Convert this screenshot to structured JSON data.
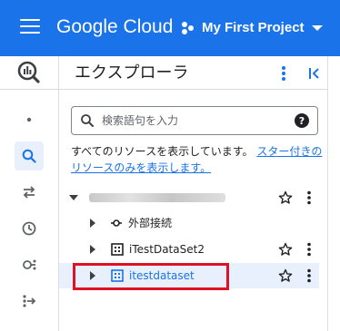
{
  "topbar": {
    "menu_icon": "hamburger-menu-icon",
    "logo_text": "Google Cloud",
    "project_name": "My First Project",
    "project_icon": "project-dots-icon",
    "dropdown_icon": "caret-down-icon"
  },
  "rail": {
    "items": [
      {
        "name": "bigquery-logo",
        "icon": "bigquery-icon"
      },
      {
        "name": "overview",
        "icon": "dot-icon"
      },
      {
        "name": "search",
        "icon": "search-icon",
        "active": true
      },
      {
        "name": "transfers",
        "icon": "swap-icon"
      },
      {
        "name": "scheduled-queries",
        "icon": "clock-icon"
      },
      {
        "name": "analytics-hub",
        "icon": "hub-icon"
      },
      {
        "name": "migration",
        "icon": "migration-icon"
      }
    ]
  },
  "explorer": {
    "title": "エクスプローラ",
    "search_placeholder": "検索語句を入力",
    "search_value": "",
    "info_text": "すべてのリソースを表示しています。",
    "info_link": "スター付きのリソースのみを表示します。",
    "tree": {
      "project_label": "",
      "children": [
        {
          "label": "外部接続",
          "icon": "connection-icon"
        },
        {
          "label": "iTestDataSet2",
          "icon": "dataset-icon"
        },
        {
          "label": "itestdataset",
          "icon": "dataset-icon",
          "selected": true
        }
      ]
    }
  },
  "colors": {
    "brand": "#1a73e8",
    "selection": "#e8f0fe",
    "highlight": "#e01025"
  }
}
